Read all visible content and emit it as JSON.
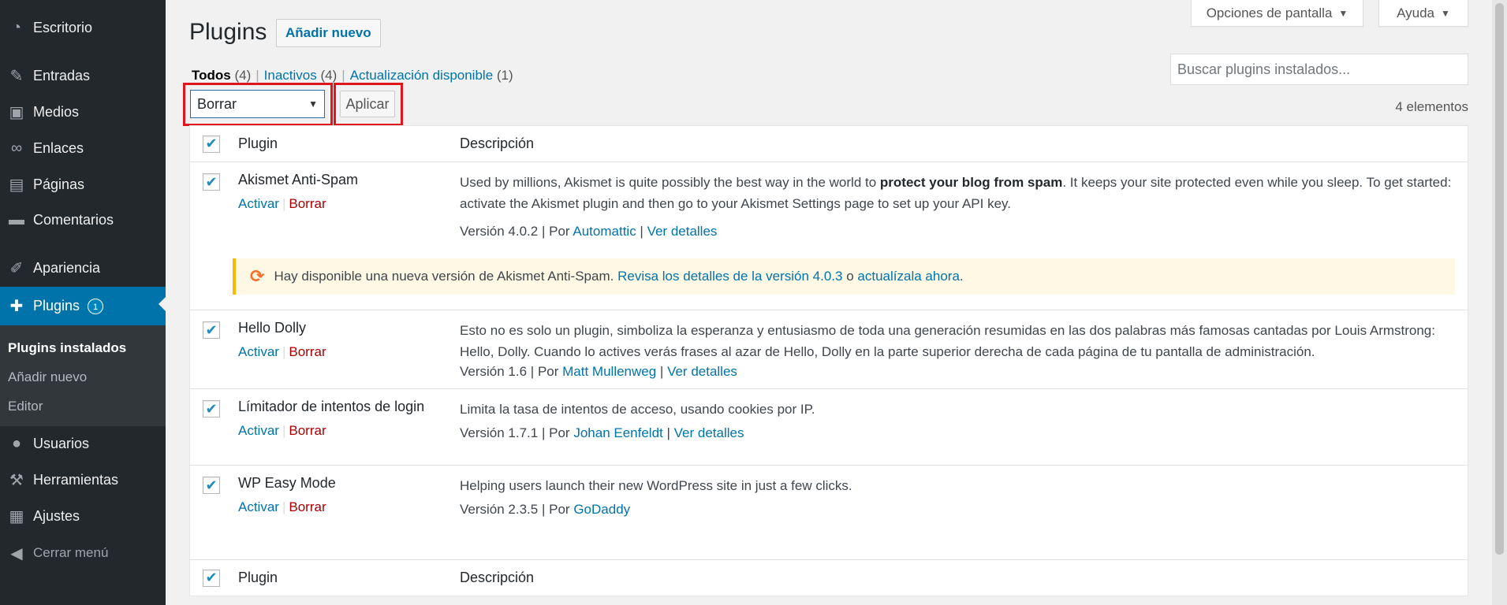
{
  "sidebar": {
    "dashboard": {
      "label": "Escritorio",
      "icon": "dashboard-icon"
    },
    "posts": {
      "label": "Entradas",
      "icon": "pin-icon"
    },
    "media": {
      "label": "Medios",
      "icon": "media-icon"
    },
    "links": {
      "label": "Enlaces",
      "icon": "link-icon"
    },
    "pages": {
      "label": "Páginas",
      "icon": "pages-icon"
    },
    "comments": {
      "label": "Comentarios",
      "icon": "comment-icon"
    },
    "appearance": {
      "label": "Apariencia",
      "icon": "brush-icon"
    },
    "plugins": {
      "label": "Plugins",
      "badge": "1",
      "icon": "plugin-icon"
    },
    "submenu": {
      "installed": "Plugins instalados",
      "add_new": "Añadir nuevo",
      "editor": "Editor"
    },
    "users": {
      "label": "Usuarios",
      "icon": "user-icon"
    },
    "tools": {
      "label": "Herramientas",
      "icon": "wrench-icon"
    },
    "settings": {
      "label": "Ajustes",
      "icon": "settings-icon"
    },
    "collapse": {
      "label": "Cerrar menú",
      "icon": "collapse-icon"
    }
  },
  "screen_options": {
    "label": "Opciones de pantalla"
  },
  "help": {
    "label": "Ayuda"
  },
  "header": {
    "title": "Plugins",
    "add_new": "Añadir nuevo"
  },
  "views": {
    "all": {
      "label": "Todos",
      "count": "(4)"
    },
    "inactive": {
      "label": "Inactivos",
      "count": "(4)"
    },
    "update": {
      "label": "Actualización disponible",
      "count": "(1)"
    }
  },
  "search": {
    "placeholder": "Buscar plugins instalados..."
  },
  "bulk": {
    "selected": "Borrar",
    "apply": "Aplicar"
  },
  "items_count": "4 elementos",
  "table": {
    "columns": {
      "plugin": "Plugin",
      "description": "Descripción"
    },
    "rows": [
      {
        "name": "Akismet Anti-Spam",
        "activate": "Activar",
        "delete": "Borrar",
        "desc_before": "Used by millions, Akismet is quite possibly the best way in the world to ",
        "desc_strong": "protect your blog from spam",
        "desc_after": ". It keeps your site protected even while you sleep. To get started: activate the Akismet plugin and then go to your Akismet Settings page to set up your API key.",
        "version": "Versión 4.0.2",
        "by": "Por",
        "author": "Automattic",
        "details": "Ver detalles"
      },
      {
        "name": "Hello Dolly",
        "activate": "Activar",
        "delete": "Borrar",
        "desc": "Esto no es solo un plugin, simboliza la esperanza y entusiasmo de toda una generación resumidas en las dos palabras más famosas cantadas por Louis Armstrong: Hello, Dolly. Cuando lo actives verás frases al azar de Hello, Dolly en la parte superior derecha de cada página de tu pantalla de administración.",
        "version": "Versión 1.6",
        "by": "Por",
        "author": "Matt Mullenweg",
        "details": "Ver detalles"
      },
      {
        "name": "Límitador de intentos de login",
        "activate": "Activar",
        "delete": "Borrar",
        "desc": "Limita la tasa de intentos de acceso, usando cookies por IP.",
        "version": "Versión 1.7.1",
        "by": "Por",
        "author": "Johan Eenfeldt",
        "details": "Ver detalles"
      },
      {
        "name": "WP Easy Mode",
        "activate": "Activar",
        "delete": "Borrar",
        "desc": "Helping users launch their new WordPress site in just a few clicks.",
        "version": "Versión 2.3.5",
        "by": "Por",
        "author": "GoDaddy"
      }
    ],
    "update_notice": {
      "text": "Hay disponible una nueva versión de Akismet Anti-Spam.",
      "link1": "Revisa los detalles de la versión 4.0.3",
      "middle": "o",
      "link2": "actualízala ahora",
      "end": "."
    }
  },
  "colors": {
    "highlight": "#e0161d",
    "accent": "#0073aa",
    "delete": "#a00",
    "sidebar": "#23282d"
  }
}
